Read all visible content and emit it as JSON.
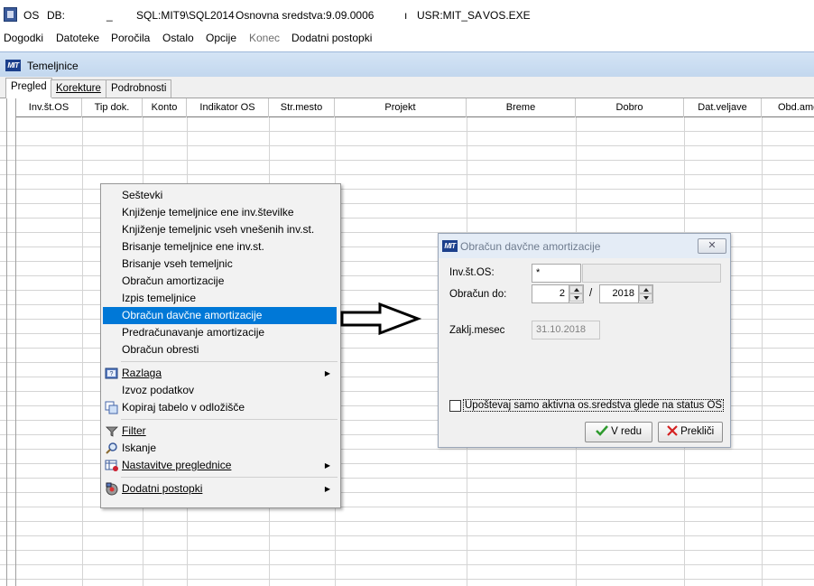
{
  "titlebar": {
    "app": "OS",
    "db_label": "DB:",
    "db_value": "_",
    "server": "SQL:MIT9\\SQL2014",
    "module": "Osnovna sredstva:9.09.0006",
    "separator": "ı",
    "user": "USR:MIT_SA",
    "exe": "VOS.EXE"
  },
  "menubar": {
    "items": [
      "Dogodki",
      "Datoteke",
      "Poročila",
      "Ostalo",
      "Opcije",
      "Konec",
      "Dodatni postopki"
    ]
  },
  "subwindow": {
    "logo": "MIT",
    "title": "Temeljnice"
  },
  "tabs": [
    "Pregled",
    "Korekture",
    "Podrobnosti"
  ],
  "grid": {
    "columns": [
      "Inv.št.OS",
      "Tip dok.",
      "Konto",
      "Indikator OS",
      "Str.mesto",
      "Projekt",
      "Breme",
      "Dobro",
      "Dat.veljave",
      "Obd.amo"
    ]
  },
  "context_menu": {
    "group1": [
      "Seštevki",
      "Knjiženje temeljnice ene inv.številke",
      "Knjiženje temeljnic vseh vnešenih inv.st.",
      "Brisanje temeljnice ene inv.st.",
      "Brisanje vseh temeljnic",
      "Obračun amortizacije",
      "Izpis temeljnice",
      "Obračun davčne amortizacije",
      "Predračunavanje amortizacije",
      "Obračun obresti"
    ],
    "group2": [
      "Razlaga",
      "Izvoz podatkov",
      "Kopiraj tabelo v odložišče"
    ],
    "group3": [
      "Filter",
      "Iskanje",
      "Nastavitve preglednice"
    ],
    "group4": [
      "Dodatni postopki"
    ],
    "icons": {
      "razlaga": "help-book-icon",
      "kopiraj": "copy-table-icon",
      "filter": "filter-funnel-icon",
      "iskanje": "search-magnifier-icon",
      "nastavitve": "grid-settings-icon",
      "dodatni": "tools-gear-icon"
    },
    "selected_item": "Obračun davčne amortizacije"
  },
  "dialog": {
    "title": "Obračun davčne amortizacije",
    "inv_label": "Inv.št.OS:",
    "inv_value": "*",
    "inv_desc": "",
    "obracun_label": "Obračun do:",
    "month": "2",
    "slash": "/",
    "year": "2018",
    "zakl_label": "Zaklj.mesec",
    "zakl_value": "31.10.2018",
    "checkbox_label": "Upoštevaj samo aktivna os.sredstva glede na status OS",
    "ok_label": "V redu",
    "cancel_label": "Prekliči",
    "close_symbol": "✕"
  },
  "colors": {
    "accent": "#0078d7",
    "subwin_title": "#c9dcf1",
    "ok_icon": "#2e9a2e",
    "cancel_icon": "#d42020"
  }
}
